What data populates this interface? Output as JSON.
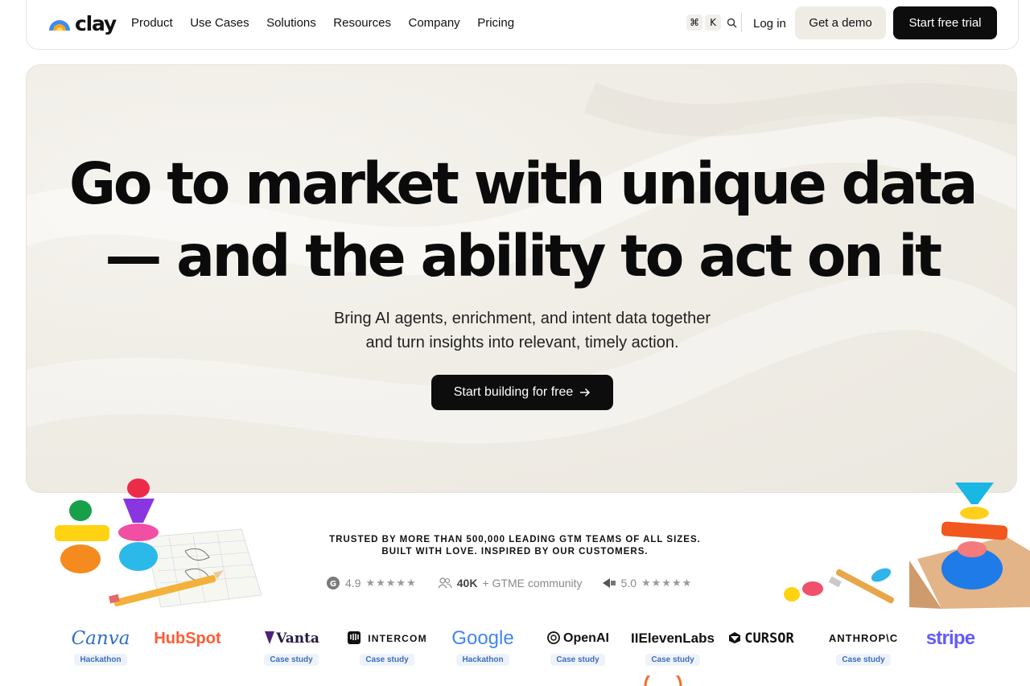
{
  "nav": {
    "logo_text": "clay",
    "links": [
      "Product",
      "Use Cases",
      "Solutions",
      "Resources",
      "Company",
      "Pricing"
    ],
    "shortcut_keys": [
      "⌘",
      "K"
    ],
    "search_icon": "search-icon",
    "login": "Log in",
    "demo": "Get a demo",
    "trial": "Start free trial"
  },
  "hero": {
    "headline_line1": "Go to market with unique data",
    "headline_line2": "— and the ability to act on it",
    "sub_line1": "Bring AI agents, enrichment, and intent data together",
    "sub_line2": "and turn insights into relevant, timely action.",
    "cta": "Start building for free",
    "cta_icon": "arrow-right-icon"
  },
  "trusted": {
    "line1": "TRUSTED BY MORE THAN 500,000 LEADING GTM TEAMS OF ALL SIZES.",
    "line2": "BUILT WITH LOVE. INSPIRED BY OUR CUSTOMERS."
  },
  "ratings": {
    "g2_score": "4.9",
    "stars": "★★★★★",
    "community_count": "40K",
    "community_label": "+ GTME community",
    "review_score": "5.0"
  },
  "brands": [
    {
      "name": "Canva",
      "badge": "Hackathon"
    },
    {
      "name": "HubSpot",
      "badge": ""
    },
    {
      "name": "Vanta",
      "badge": "Case study"
    },
    {
      "name": "INTERCOM",
      "badge": "Case study"
    },
    {
      "name": "Google",
      "badge": "Hackathon"
    },
    {
      "name": "OpenAI",
      "badge": "Case study"
    },
    {
      "name": "IIElevenLabs",
      "badge": "Case study"
    },
    {
      "name": "CURSOR",
      "badge": ""
    },
    {
      "name": "ANTHROP\\C",
      "badge": "Case study"
    },
    {
      "name": "stripe",
      "badge": ""
    }
  ],
  "colors": {
    "accent_dark": "#0d0d0d",
    "hero_bg": "#f0ede6",
    "badge_bg": "#eef3fb",
    "badge_text": "#3f6db8",
    "canva": "#2f6fc2",
    "hubspot": "#ff5c35",
    "google_blue": "#4285f4",
    "stripe": "#635bff"
  }
}
